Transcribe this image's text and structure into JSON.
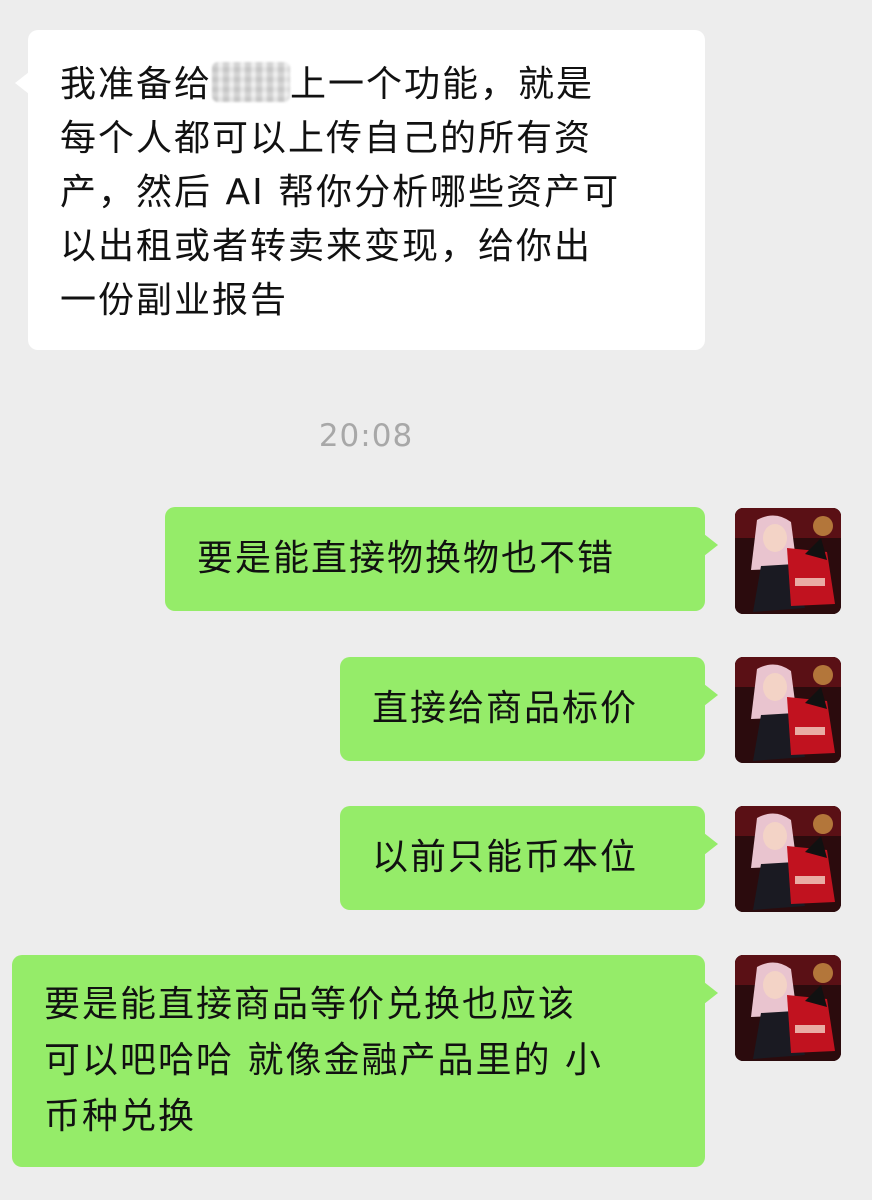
{
  "conversation": {
    "timestamp": "20:08",
    "messages": [
      {
        "side": "in",
        "segments": [
          "我准备给",
          "上一个功能，就是"
        ],
        "lines": [
          "每个人都可以上传自己的所有资",
          "产，然后 AI 帮你分析哪些资产可",
          "以出租或者转卖来变现，给你出",
          "一份副业报告"
        ]
      },
      {
        "side": "out",
        "text": "要是能直接物换物也不错"
      },
      {
        "side": "out",
        "text": "直接给商品标价"
      },
      {
        "side": "out",
        "text": "以前只能币本位"
      },
      {
        "side": "out",
        "lines": [
          "要是能直接商品等价兑换也应该",
          "可以吧哈哈 就像金融产品里的 小",
          "币种兑换"
        ]
      }
    ]
  },
  "avatar": {
    "icon": "anime-avatar-icon",
    "colors": {
      "background": "#2b0b0d",
      "dress": "#c1121f",
      "hair": "#e9c4cf",
      "skin": "#f3d3c6"
    }
  }
}
